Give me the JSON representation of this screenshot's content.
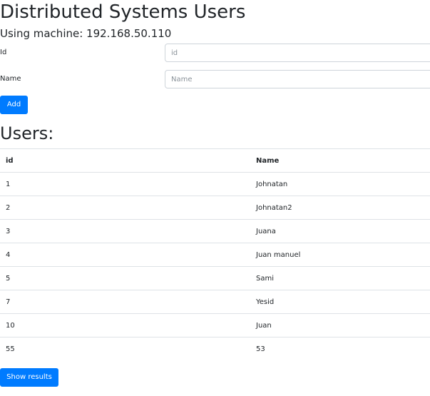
{
  "header": {
    "title": "Distributed Systems Users",
    "machine_label": "Using machine: 192.168.50.110"
  },
  "form": {
    "id_label": "Id",
    "id_placeholder": "id",
    "id_value": "",
    "name_label": "Name",
    "name_placeholder": "Name",
    "name_value": "",
    "add_label": "Add"
  },
  "users": {
    "heading": "Users:",
    "columns": [
      "id",
      "Name"
    ],
    "rows": [
      [
        "1",
        "Johnatan"
      ],
      [
        "2",
        "Johnatan2"
      ],
      [
        "3",
        "Juana"
      ],
      [
        "4",
        "Juan manuel"
      ],
      [
        "5",
        "Sami"
      ],
      [
        "7",
        "Yesid"
      ],
      [
        "10",
        "Juan"
      ],
      [
        "55",
        "53"
      ]
    ],
    "show_results_label": "Show results"
  },
  "colors": {
    "primary": "#007bff",
    "border": "#dee2e6",
    "input_border": "#ced4da",
    "text": "#212529"
  }
}
